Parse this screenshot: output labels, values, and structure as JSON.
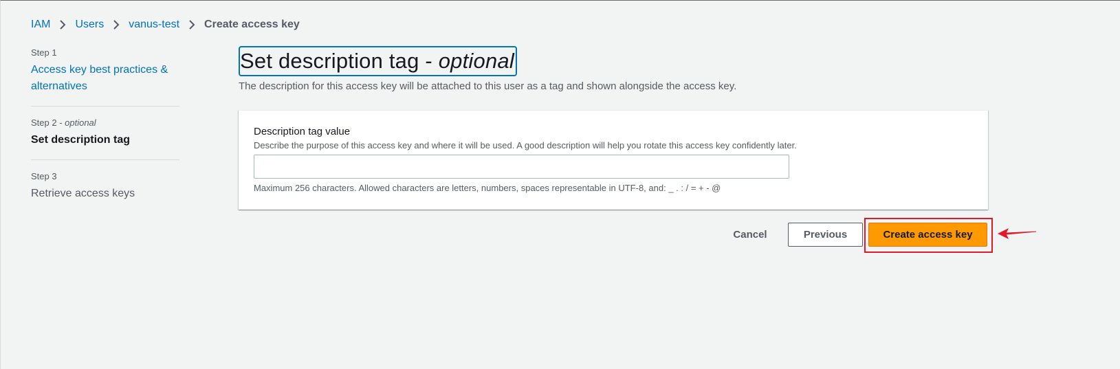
{
  "breadcrumb": {
    "items": [
      {
        "label": "IAM"
      },
      {
        "label": "Users"
      },
      {
        "label": "vanus-test"
      }
    ],
    "current": "Create access key"
  },
  "steps": [
    {
      "number": "Step 1",
      "optional": "",
      "title": "Access key best practices & alternatives",
      "state": "link"
    },
    {
      "number": "Step 2 - ",
      "optional": "optional",
      "title": "Set description tag",
      "state": "active"
    },
    {
      "number": "Step 3",
      "optional": "",
      "title": "Retrieve access keys",
      "state": "pending"
    }
  ],
  "page": {
    "title_main": "Set description tag - ",
    "title_optional": "optional",
    "description": "The description for this access key will be attached to this user as a tag and shown alongside the access key."
  },
  "form": {
    "label": "Description tag value",
    "description": "Describe the purpose of this access key and where it will be used. A good description will help you rotate this access key confidently later.",
    "value": "",
    "constraint": "Maximum 256 characters. Allowed characters are letters, numbers, spaces representable in UTF-8, and: _ . : / = + - @"
  },
  "actions": {
    "cancel": "Cancel",
    "previous": "Previous",
    "create": "Create access key"
  },
  "colors": {
    "link": "#0073bb",
    "primary": "#ff9900",
    "annotation": "#e01a2b"
  },
  "icons": {
    "breadcrumb_separator": "chevron-right-icon",
    "annotation_arrow": "arrow-left-icon"
  }
}
